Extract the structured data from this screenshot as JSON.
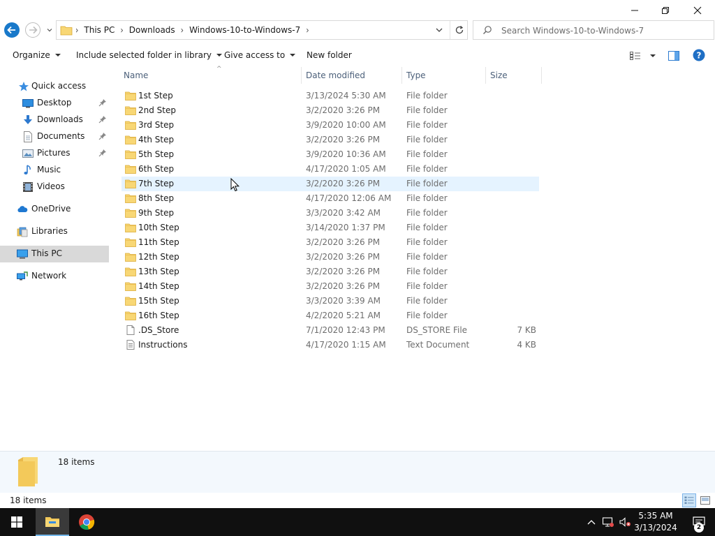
{
  "window": {
    "minimize_icon": "minimize-icon",
    "maximize_icon": "restore-icon",
    "close_icon": "close-icon"
  },
  "address": {
    "breadcrumbs": [
      "This PC",
      "Downloads",
      "Windows-10-to-Windows-7"
    ],
    "search_placeholder": "Search Windows-10-to-Windows-7"
  },
  "toolbar": {
    "organize": "Organize",
    "include_in_library": "Include selected folder in library",
    "give_access": "Give access to",
    "new_folder": "New folder"
  },
  "sidebar": {
    "items": [
      {
        "label": "Quick access",
        "icon": "star-icon"
      },
      {
        "label": "Desktop",
        "icon": "desktop-icon",
        "pinned": true
      },
      {
        "label": "Downloads",
        "icon": "download-icon",
        "pinned": true
      },
      {
        "label": "Documents",
        "icon": "documents-icon",
        "pinned": true
      },
      {
        "label": "Pictures",
        "icon": "pictures-icon",
        "pinned": true
      },
      {
        "label": "Music",
        "icon": "music-icon"
      },
      {
        "label": "Videos",
        "icon": "videos-icon"
      },
      {
        "label": "OneDrive",
        "icon": "cloud-icon"
      },
      {
        "label": "Libraries",
        "icon": "libraries-icon"
      },
      {
        "label": "This PC",
        "icon": "computer-icon",
        "selected": true
      },
      {
        "label": "Network",
        "icon": "network-icon"
      }
    ]
  },
  "columns": {
    "name": "Name",
    "date": "Date modified",
    "type": "Type",
    "size": "Size"
  },
  "files": [
    {
      "name": "1st Step",
      "date": "3/13/2024 5:30 AM",
      "type": "File folder",
      "size": "",
      "kind": "folder"
    },
    {
      "name": "2nd Step",
      "date": "3/2/2020 3:26 PM",
      "type": "File folder",
      "size": "",
      "kind": "folder"
    },
    {
      "name": "3rd Step",
      "date": "3/9/2020 10:00 AM",
      "type": "File folder",
      "size": "",
      "kind": "folder"
    },
    {
      "name": "4th Step",
      "date": "3/2/2020 3:26 PM",
      "type": "File folder",
      "size": "",
      "kind": "folder"
    },
    {
      "name": "5th Step",
      "date": "3/9/2020 10:36 AM",
      "type": "File folder",
      "size": "",
      "kind": "folder"
    },
    {
      "name": "6th Step",
      "date": "4/17/2020 1:05 AM",
      "type": "File folder",
      "size": "",
      "kind": "folder"
    },
    {
      "name": "7th Step",
      "date": "3/2/2020 3:26 PM",
      "type": "File folder",
      "size": "",
      "kind": "folder",
      "hover": true
    },
    {
      "name": "8th Step",
      "date": "4/17/2020 12:06 AM",
      "type": "File folder",
      "size": "",
      "kind": "folder"
    },
    {
      "name": "9th Step",
      "date": "3/3/2020 3:42 AM",
      "type": "File folder",
      "size": "",
      "kind": "folder"
    },
    {
      "name": "10th Step",
      "date": "3/14/2020 1:37 PM",
      "type": "File folder",
      "size": "",
      "kind": "folder"
    },
    {
      "name": "11th Step",
      "date": "3/2/2020 3:26 PM",
      "type": "File folder",
      "size": "",
      "kind": "folder"
    },
    {
      "name": "12th Step",
      "date": "3/2/2020 3:26 PM",
      "type": "File folder",
      "size": "",
      "kind": "folder"
    },
    {
      "name": "13th Step",
      "date": "3/2/2020 3:26 PM",
      "type": "File folder",
      "size": "",
      "kind": "folder"
    },
    {
      "name": "14th Step",
      "date": "3/2/2020 3:26 PM",
      "type": "File folder",
      "size": "",
      "kind": "folder"
    },
    {
      "name": "15th Step",
      "date": "3/3/2020 3:39 AM",
      "type": "File folder",
      "size": "",
      "kind": "folder"
    },
    {
      "name": "16th Step",
      "date": "4/2/2020 5:21 AM",
      "type": "File folder",
      "size": "",
      "kind": "folder"
    },
    {
      "name": ".DS_Store",
      "date": "7/1/2020 12:43 PM",
      "type": "DS_STORE File",
      "size": "7 KB",
      "kind": "file"
    },
    {
      "name": "Instructions",
      "date": "4/17/2020 1:15 AM",
      "type": "Text Document",
      "size": "4 KB",
      "kind": "text"
    }
  ],
  "details": {
    "count": "18 items"
  },
  "statusbar": {
    "count": "18 items"
  },
  "taskbar": {
    "time": "5:35 AM",
    "date": "3/13/2024",
    "notification_count": "2"
  }
}
